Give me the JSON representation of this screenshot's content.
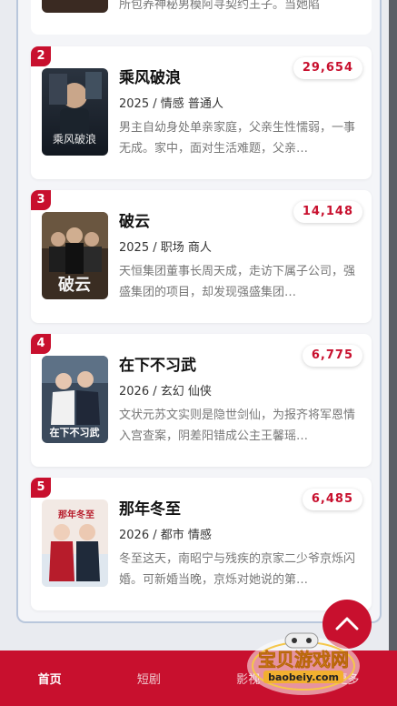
{
  "top_item": {
    "desc": "所包养神秘男模阿寻契约王子。当她陷"
  },
  "items": [
    {
      "rank": "2",
      "title": "乘风破浪",
      "meta": "2025 / 情感 普通人",
      "desc": "男主自幼身处单亲家庭，父亲生性懦弱，一事无成。家中，面对生活难题，父亲…",
      "views": "29,654",
      "poster_label": "乘风破浪"
    },
    {
      "rank": "3",
      "title": "破云",
      "meta": "2025 / 职场 商人",
      "desc": "天恒集团董事长周天成，走访下属子公司，强盛集团的项目，却发现强盛集团…",
      "views": "14,148",
      "poster_label": "破云"
    },
    {
      "rank": "4",
      "title": "在下不习武",
      "meta": "2026 / 玄幻 仙侠",
      "desc": "文状元苏文实则是隐世剑仙，为报齐将军恩情入宫查案，阴差阳错成公主王馨瑶…",
      "views": "6,775",
      "poster_label": "在下不习武"
    },
    {
      "rank": "5",
      "title": "那年冬至",
      "meta": "2026 / 都市 情感",
      "desc": "冬至这天，南昭宁与残疾的京家二少爷京烁闪婚。可新婚当晚，京烁对她说的第…",
      "views": "6,485",
      "poster_label": "那年冬至"
    }
  ],
  "nav": [
    {
      "label": "首页",
      "active": true
    },
    {
      "label": "短剧",
      "active": false
    },
    {
      "label": "影视",
      "active": false
    },
    {
      "label": "更多",
      "active": false
    }
  ],
  "watermark": {
    "title": "宝贝游戏网",
    "url": "baobeiy.com"
  },
  "colors": {
    "accent": "#c8102e",
    "background": "#e9ebf0",
    "card": "#ffffff"
  }
}
